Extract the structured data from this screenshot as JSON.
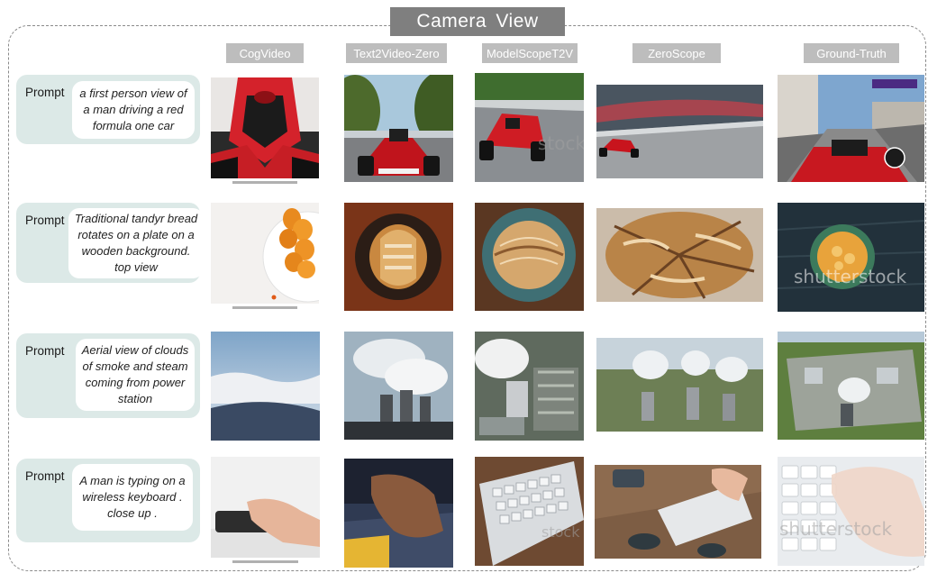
{
  "title": "Camera  View",
  "columns": [
    "CogVideo",
    "Text2Video-Zero",
    "ModelScopeT2V",
    "ZeroScope",
    "Ground-Truth"
  ],
  "rows": [
    {
      "label": "Prompt",
      "text": "a first person view of a man driving a red formula one car"
    },
    {
      "label": "Prompt",
      "text": "Traditional tandyr bread rotates on a plate on a wooden background. top view"
    },
    {
      "label": "Prompt",
      "text": "Aerial view of clouds of smoke and steam coming from power station"
    },
    {
      "label": "Prompt",
      "text": "A man is typing on a wireless keyboard . close up ."
    }
  ],
  "watermarks": {
    "stock_text": "stock",
    "shutterstock_text": "shutterstock"
  },
  "colors": {
    "title_bg": "#7f7f7f",
    "header_bg": "#bdbdbd",
    "prompt_card_bg": "#dce9e7"
  }
}
